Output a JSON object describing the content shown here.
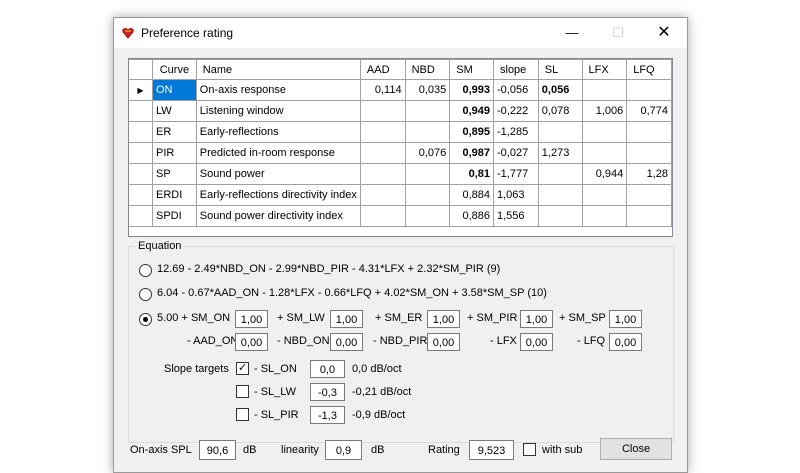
{
  "window": {
    "title": "Preference rating",
    "min": "—",
    "max": "☐",
    "close": "✕"
  },
  "grid": {
    "headers": [
      "Curve",
      "Name",
      "AAD",
      "NBD",
      "SM",
      "slope",
      "SL",
      "LFX",
      "LFQ"
    ],
    "rows": [
      {
        "curve": "ON",
        "name": "On-axis response",
        "aad": "0,114",
        "nbd": "0,035",
        "sm": "0,993",
        "slope": "-0,056",
        "sl": "0,056",
        "lfx": "",
        "lfq": ""
      },
      {
        "curve": "LW",
        "name": "Listening window",
        "aad": "",
        "nbd": "",
        "sm": "0,949",
        "slope": "-0,222",
        "sl": "0,078",
        "lfx": "1,006",
        "lfq": "0,774"
      },
      {
        "curve": "ER",
        "name": "Early-reflections",
        "aad": "",
        "nbd": "",
        "sm": "0,895",
        "slope": "-1,285",
        "sl": "",
        "lfx": "",
        "lfq": ""
      },
      {
        "curve": "PIR",
        "name": "Predicted in-room response",
        "aad": "",
        "nbd": "0,076",
        "sm": "0,987",
        "slope": "-0,027",
        "sl": "1,273",
        "lfx": "",
        "lfq": ""
      },
      {
        "curve": "SP",
        "name": "Sound power",
        "aad": "",
        "nbd": "",
        "sm": "0,81",
        "slope": "-1,777",
        "sl": "",
        "lfx": "0,944",
        "lfq": "1,28"
      },
      {
        "curve": "ERDI",
        "name": "Early-reflections directivity index",
        "aad": "",
        "nbd": "",
        "sm": "0,884",
        "slope": "1,063",
        "sl": "",
        "lfx": "",
        "lfq": ""
      },
      {
        "curve": "SPDI",
        "name": "Sound power directivity index",
        "aad": "",
        "nbd": "",
        "sm": "0,886",
        "slope": "1,556",
        "sl": "",
        "lfx": "",
        "lfq": ""
      }
    ]
  },
  "equation": {
    "label": "Equation",
    "option1": "12.69 - 2.49*NBD_ON - 2.99*NBD_PIR - 4.31*LFX + 2.32*SM_PIR (9)",
    "option2": "6.04 - 0.67*AAD_ON - 1.28*LFX - 0.66*LFQ + 4.02*SM_ON + 3.58*SM_SP (10)",
    "option3_prefix": "5.00 + SM_ON",
    "sm_lw": "+ SM_LW",
    "sm_er": "+ SM_ER",
    "sm_pir": "+ SM_PIR",
    "sm_sp": "+ SM_SP",
    "aad_on": "- AAD_ON",
    "nbd_on": "- NBD_ON",
    "nbd_pir": "- NBD_PIR",
    "lfx": "- LFX",
    "lfq": "- LFQ",
    "values": {
      "sm_on": "1,00",
      "sm_lw": "1,00",
      "sm_er": "1,00",
      "sm_pir": "1,00",
      "sm_sp": "1,00",
      "aad_on": "0,00",
      "nbd_on": "0,00",
      "nbd_pir": "0,00",
      "lfx": "0,00",
      "lfq": "0,00"
    },
    "slope_label": "Slope targets",
    "sl_on": {
      "label": "- SL_ON",
      "value": "0,0",
      "readout": "0,0 dB/oct",
      "checked": true
    },
    "sl_lw": {
      "label": "- SL_LW",
      "value": "-0,3",
      "readout": "-0,21 dB/oct",
      "checked": false
    },
    "sl_pir": {
      "label": "- SL_PIR",
      "value": "-1,3",
      "readout": "-0,9 dB/oct",
      "checked": false
    }
  },
  "footer": {
    "spl_label": "On-axis SPL",
    "spl_value": "90,6",
    "spl_unit": "dB",
    "lin_label": "linearity",
    "lin_value": "0,9",
    "lin_unit": "dB",
    "rating_label": "Rating",
    "rating_value": "9,523",
    "sub_label": "with sub",
    "close_label": "Close"
  }
}
